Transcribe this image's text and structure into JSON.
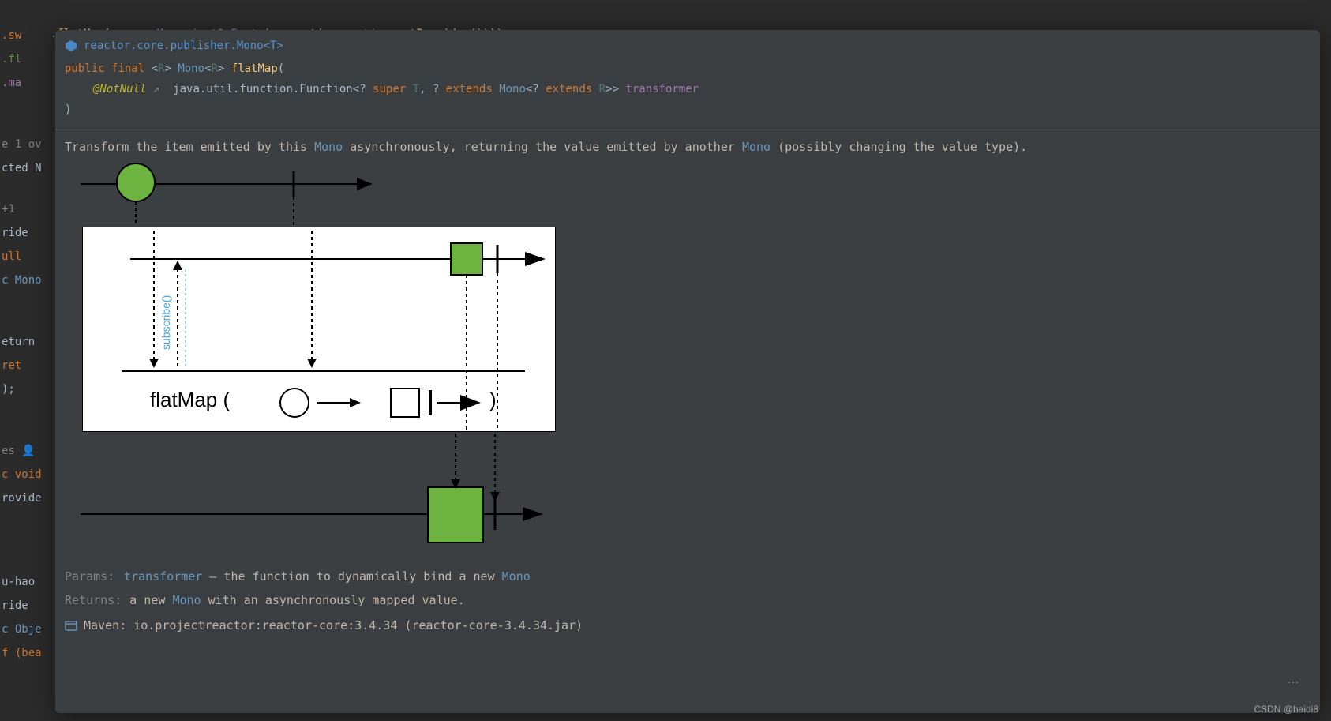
{
  "editor": {
    "line1": {
      "prefix": ".",
      "method": "flatMap",
      "lparen": "(",
      "param": "map ",
      "arrow": "-> ",
      "mono": "Mono",
      "dot": ".",
      "justOrEmpty": "justOrEmpty",
      "lparen2": "(",
      "mapget": "map.get(",
      "properties": "properties",
      "dot2": ".",
      "getProvider": "getProvider",
      "close": "())))"
    },
    "line2": ".sw",
    "line3": ".fl",
    "line4": ".ma"
  },
  "left_fragments": [
    "",
    "",
    "",
    "",
    "",
    "",
    "e  1 ov",
    "cted N",
    "",
    "+1",
    "ride",
    "ull",
    "c Mono",
    "",
    "",
    "eturn",
    "    ret",
    ");",
    "",
    "",
    "es  👤",
    "c void",
    "rovide",
    "",
    "",
    "",
    "u-hao",
    "ride",
    "c Obje",
    "f (bea"
  ],
  "doc": {
    "class_name": "reactor.core.publisher.Mono<T>",
    "sig_public": "public ",
    "sig_final": "final ",
    "sig_lt": "<",
    "sig_R": "R",
    "sig_gt": "> ",
    "sig_Mono": "Mono",
    "sig_ltR": "<",
    "sig_R2": "R",
    "sig_gt2": "> ",
    "sig_flatMap": "flatMap",
    "sig_open": "(",
    "sig_notnull": "@NotNull",
    "sig_arrow": " ↗  ",
    "sig_pkg": "java.util.function.Function",
    "sig_lt2": "<? ",
    "sig_super": "super ",
    "sig_T": "T",
    "sig_comma": ", ? ",
    "sig_extends1": "extends ",
    "sig_Mono2": "Mono",
    "sig_lt3": "<? ",
    "sig_extends2": "extends ",
    "sig_R3": "R",
    "sig_close1": ">> ",
    "sig_transformer": "transformer",
    "sig_close2": ")",
    "desc_pre": "Transform the item emitted by this ",
    "desc_mono1": "Mono",
    "desc_mid": " asynchronously, returning the value emitted by another ",
    "desc_mono2": "Mono",
    "desc_post": " (possibly changing the value type).",
    "flatmap_label": "flatMap (",
    "flatmap_close": ")",
    "params_label": "Params:",
    "param_name": "transformer",
    "param_desc_pre": " – the function to dynamically bind a new ",
    "param_desc_mono": "Mono",
    "returns_label": "Returns:",
    "returns_pre": "a new ",
    "returns_mono": "Mono",
    "returns_post": " with an asynchronously mapped value.",
    "maven": "Maven: io.projectreactor:reactor-core:3.4.34 (reactor-core-3.4.34.jar)"
  },
  "watermark": "CSDN @haidi8"
}
